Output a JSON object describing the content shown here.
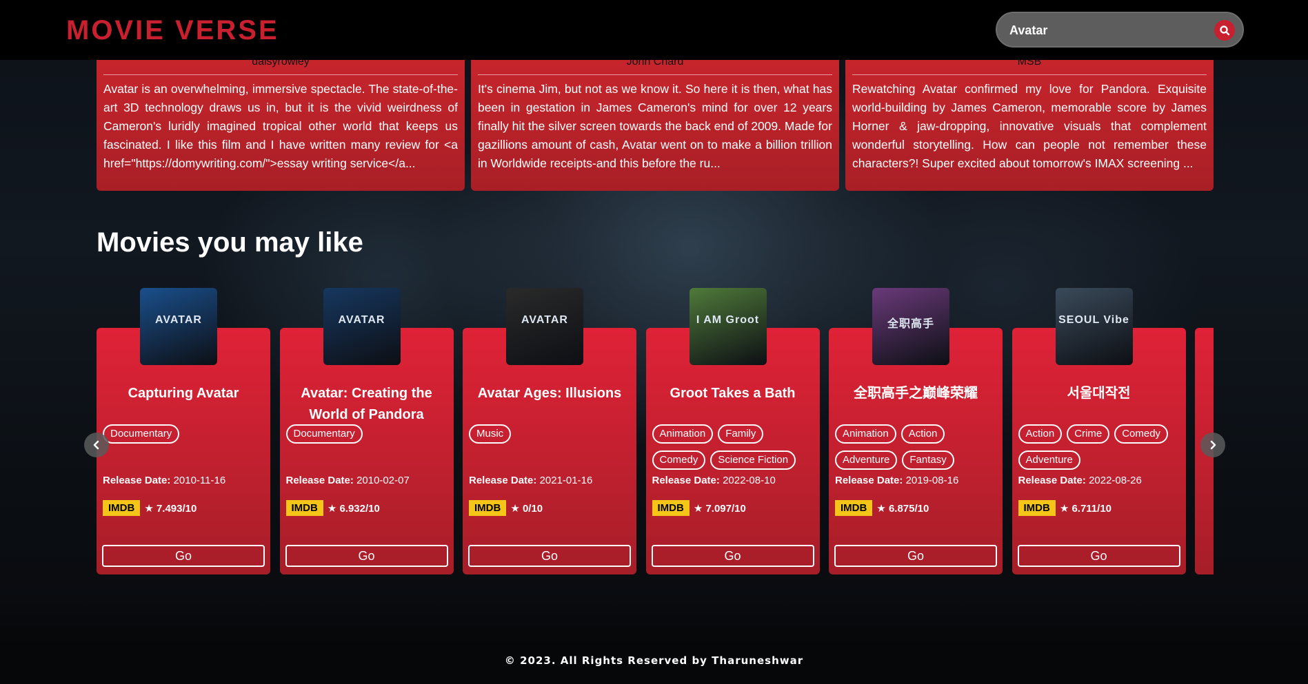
{
  "header": {
    "logo": "MOVIE VERSE",
    "search": {
      "value": "Avatar"
    }
  },
  "reviews": [
    {
      "author": "daisyrowley",
      "text": "Avatar is an overwhelming, immersive spectacle. The state-of-the-art 3D technology draws us in, but it is the vivid weirdness of Cameron's luridly imagined tropical other world that keeps us fascinated. I like this film and I have written many review for <a href=\"https://domywriting.com/\">essay writing service</a..."
    },
    {
      "author": "John Chard",
      "text": "It's cinema Jim, but not as we know it. So here it is then, what has been in gestation in James Cameron's mind for over 12 years finally hit the silver screen towards the back end of 2009. Made for gazillions amount of cash, Avatar went on to make a billion trillion in Worldwide receipts-and this before the ru..."
    },
    {
      "author": "MSB",
      "text": "Rewatching Avatar confirmed my love for Pandora. Exquisite world-building by James Cameron, memorable score by James Horner & jaw-dropping, innovative visuals that complement wonderful storytelling. How can people not remember these characters?! Super excited about tomorrow's IMAX screening ..."
    }
  ],
  "recommendations": {
    "title": "Movies you may like",
    "release_label": "Release Date:",
    "imdb_label": "IMDB",
    "go_label": "Go",
    "movies": [
      {
        "title": "Capturing Avatar",
        "genres": [
          "Documentary"
        ],
        "release": "2010-11-16",
        "rating": "★ 7.493/10",
        "poster_caption": "AVATAR",
        "poster_color": "#1a4f8c"
      },
      {
        "title": "Avatar: Creating the World of Pandora",
        "genres": [
          "Documentary"
        ],
        "release": "2010-02-07",
        "rating": "★ 6.932/10",
        "poster_caption": "AVATAR",
        "poster_color": "#16375f"
      },
      {
        "title": "Avatar Ages: Illusions",
        "genres": [
          "Music"
        ],
        "release": "2021-01-16",
        "rating": "★ 0/10",
        "poster_caption": "AVATAR",
        "poster_color": "#2a2a2a"
      },
      {
        "title": "Groot Takes a Bath",
        "genres": [
          "Animation",
          "Family",
          "Comedy",
          "Science Fiction"
        ],
        "release": "2022-08-10",
        "rating": "★ 7.097/10",
        "poster_caption": "I AM Groot",
        "poster_color": "#4f7a3a"
      },
      {
        "title": "全职高手之巅峰荣耀",
        "genres": [
          "Animation",
          "Action",
          "Adventure",
          "Fantasy"
        ],
        "release": "2019-08-16",
        "rating": "★ 6.875/10",
        "poster_caption": "全职高手",
        "poster_color": "#6a3a7a"
      },
      {
        "title": "서울대작전",
        "genres": [
          "Action",
          "Crime",
          "Comedy",
          "Adventure"
        ],
        "release": "2022-08-26",
        "rating": "★ 6.711/10",
        "poster_caption": "SEOUL Vibe",
        "poster_color": "#3a4a5a"
      }
    ]
  },
  "footer": "© 2023. All Rights Reserved by Tharuneshwar"
}
